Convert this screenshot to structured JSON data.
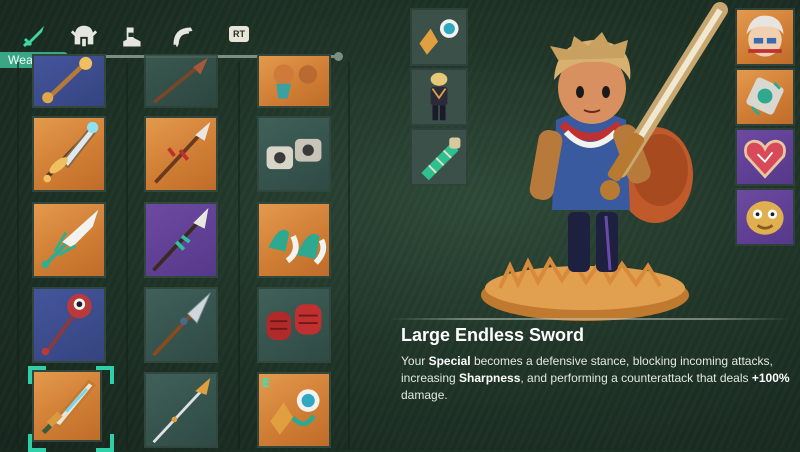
{
  "category_bar": {
    "active_label": "Weapons",
    "icons": [
      "sword-icon",
      "helmet-icon",
      "boots-icon",
      "ring-icon"
    ],
    "trigger_key": "RT"
  },
  "inventory": {
    "columns": [
      {
        "name": "weapons-column",
        "items": [
          {
            "icon": "magic-staff-icon",
            "rarity": "blue"
          },
          {
            "icon": "crystal-sword-icon",
            "rarity": "orange"
          },
          {
            "icon": "winged-spear-icon",
            "rarity": "orange"
          },
          {
            "icon": "eye-mace-icon",
            "rarity": "blue"
          },
          {
            "icon": "large-endless-sword-icon",
            "rarity": "orange",
            "selected": true
          }
        ]
      },
      {
        "name": "spears-column",
        "items": [
          {
            "icon": "rusty-spear-icon",
            "rarity": "grey"
          },
          {
            "icon": "ornate-spear-icon",
            "rarity": "orange"
          },
          {
            "icon": "jade-spear-icon",
            "rarity": "purple"
          },
          {
            "icon": "steel-spear-icon",
            "rarity": "grey"
          },
          {
            "icon": "golden-spear-icon",
            "rarity": "grey"
          }
        ]
      },
      {
        "name": "gauntlets-column",
        "items": [
          {
            "icon": "bronze-gauntlets-icon",
            "rarity": "orange"
          },
          {
            "icon": "iron-gauntlets-icon",
            "rarity": "grey"
          },
          {
            "icon": "wind-gauntlets-icon",
            "rarity": "orange"
          },
          {
            "icon": "crimson-gauntlets-icon",
            "rarity": "grey"
          },
          {
            "icon": "eye-gauntlets-icon",
            "rarity": "orange",
            "badge": "E"
          }
        ]
      }
    ]
  },
  "equipped_column": [
    {
      "icon": "eye-gauntlets-icon"
    },
    {
      "icon": "hero-outfit-icon"
    },
    {
      "icon": "green-bracer-icon"
    }
  ],
  "side_slots": [
    {
      "icon": "hero-portrait-icon",
      "rarity": "orange"
    },
    {
      "icon": "rune-charm-icon",
      "rarity": "orange"
    },
    {
      "icon": "heart-charm-icon",
      "rarity": "purple"
    },
    {
      "icon": "golden-mask-charm-icon",
      "rarity": "purple"
    }
  ],
  "selected_item": {
    "name": "Large Endless Sword",
    "description_parts": {
      "p1": "Your ",
      "b1": "Special",
      "p2": " becomes a defensive stance, blocking incoming attacks, increasing ",
      "b2": "Sharpness",
      "p3": ", and performing a counterattack that deals ",
      "b3": "+100%",
      "p4": " damage."
    }
  },
  "colors": {
    "accent": "#3aa685",
    "selection": "#2fd0a8",
    "rarity_orange": "#d9893f",
    "rarity_blue": "#3d4d8e",
    "rarity_purple": "#603f95",
    "rarity_grey": "#365550",
    "background": "#203528"
  }
}
